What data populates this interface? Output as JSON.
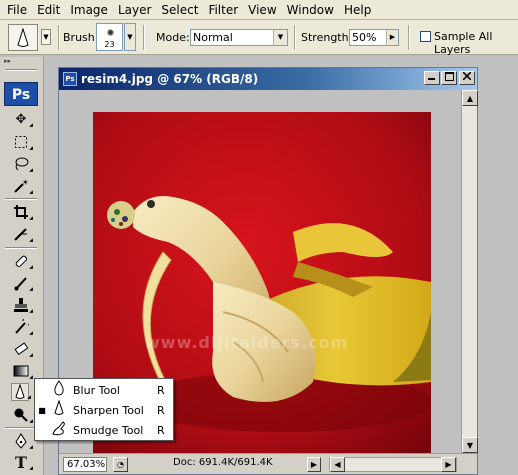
{
  "menubar": {
    "items": [
      "File",
      "Edit",
      "Image",
      "Layer",
      "Select",
      "Filter",
      "View",
      "Window",
      "Help"
    ]
  },
  "options": {
    "brush_label": "Brush:",
    "brush_size": "23",
    "mode_label": "Mode:",
    "mode_value": "Normal",
    "strength_label": "Strength:",
    "strength_value": "50%",
    "sample_all_layers_label": "Sample All Layers",
    "sample_all_layers_checked": false
  },
  "toolbox": {
    "logo": "Ps"
  },
  "document": {
    "title": "resim4.jpg @ 67% (RGB/8)",
    "title_icon": "Ps",
    "zoom": "67.03%",
    "doc_info": "Doc: 691.4K/691.4K",
    "watermark": "www.dijitalders.com"
  },
  "flyout": {
    "items": [
      {
        "label": "Blur Tool",
        "shortcut": "R",
        "icon": "blur-drop-icon",
        "selected": false
      },
      {
        "label": "Sharpen Tool",
        "shortcut": "R",
        "icon": "sharpen-cone-icon",
        "selected": true
      },
      {
        "label": "Smudge Tool",
        "shortcut": "R",
        "icon": "smudge-finger-icon",
        "selected": false
      }
    ]
  },
  "colors": {
    "menu_bg": "#ece9d8",
    "toolbox_bg": "#d4d0c8",
    "title_gradient_start": "#0a246a",
    "title_gradient_end": "#a6caf0",
    "photo_background": "#a80a12"
  }
}
